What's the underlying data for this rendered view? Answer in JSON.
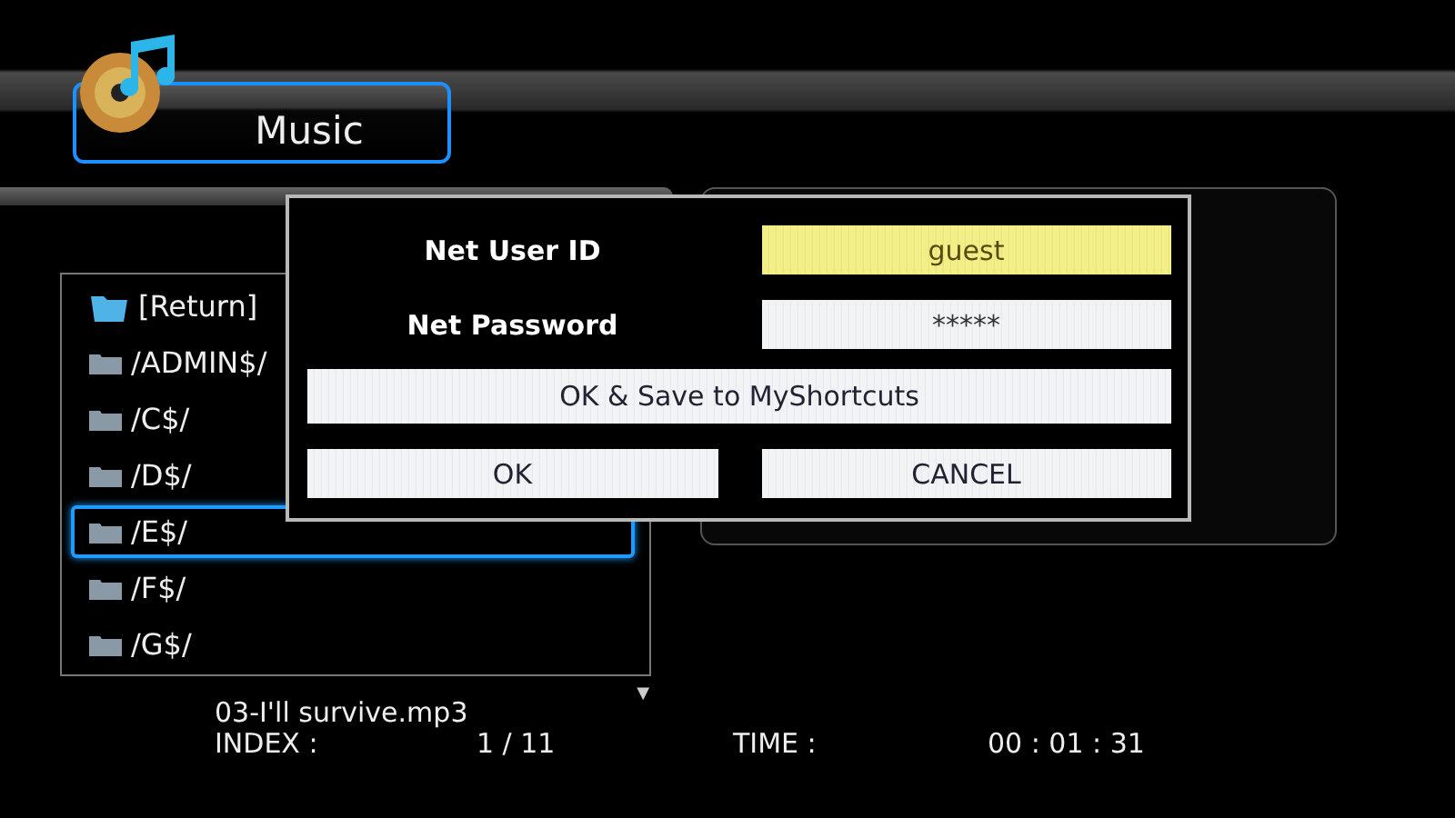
{
  "header": {
    "title": "Music"
  },
  "file_list": {
    "items": [
      {
        "label": "[Return]",
        "kind": "return",
        "selected": false
      },
      {
        "label": "/ADMIN$/",
        "kind": "folder",
        "selected": false
      },
      {
        "label": "/C$/",
        "kind": "folder",
        "selected": false
      },
      {
        "label": "/D$/",
        "kind": "folder",
        "selected": false
      },
      {
        "label": "/E$/",
        "kind": "folder",
        "selected": true
      },
      {
        "label": "/F$/",
        "kind": "folder",
        "selected": false
      },
      {
        "label": "/G$/",
        "kind": "folder",
        "selected": false
      }
    ],
    "scroll_indicator": "▼"
  },
  "now_playing": {
    "file": "03-I'll survive.mp3",
    "index_label": "INDEX :",
    "index": "1 / 11",
    "time_label": "TIME :",
    "time": "00 : 01 : 31"
  },
  "dialog": {
    "fields": [
      {
        "label": "Net User ID",
        "value": "guest",
        "focused": true
      },
      {
        "label": "Net Password",
        "value": "*****",
        "focused": false
      }
    ],
    "buttons": [
      {
        "label": "OK & Save to MyShortcuts",
        "kind": "wide"
      },
      {
        "label": "OK",
        "kind": "half"
      },
      {
        "label": "CANCEL",
        "kind": "half"
      }
    ]
  }
}
